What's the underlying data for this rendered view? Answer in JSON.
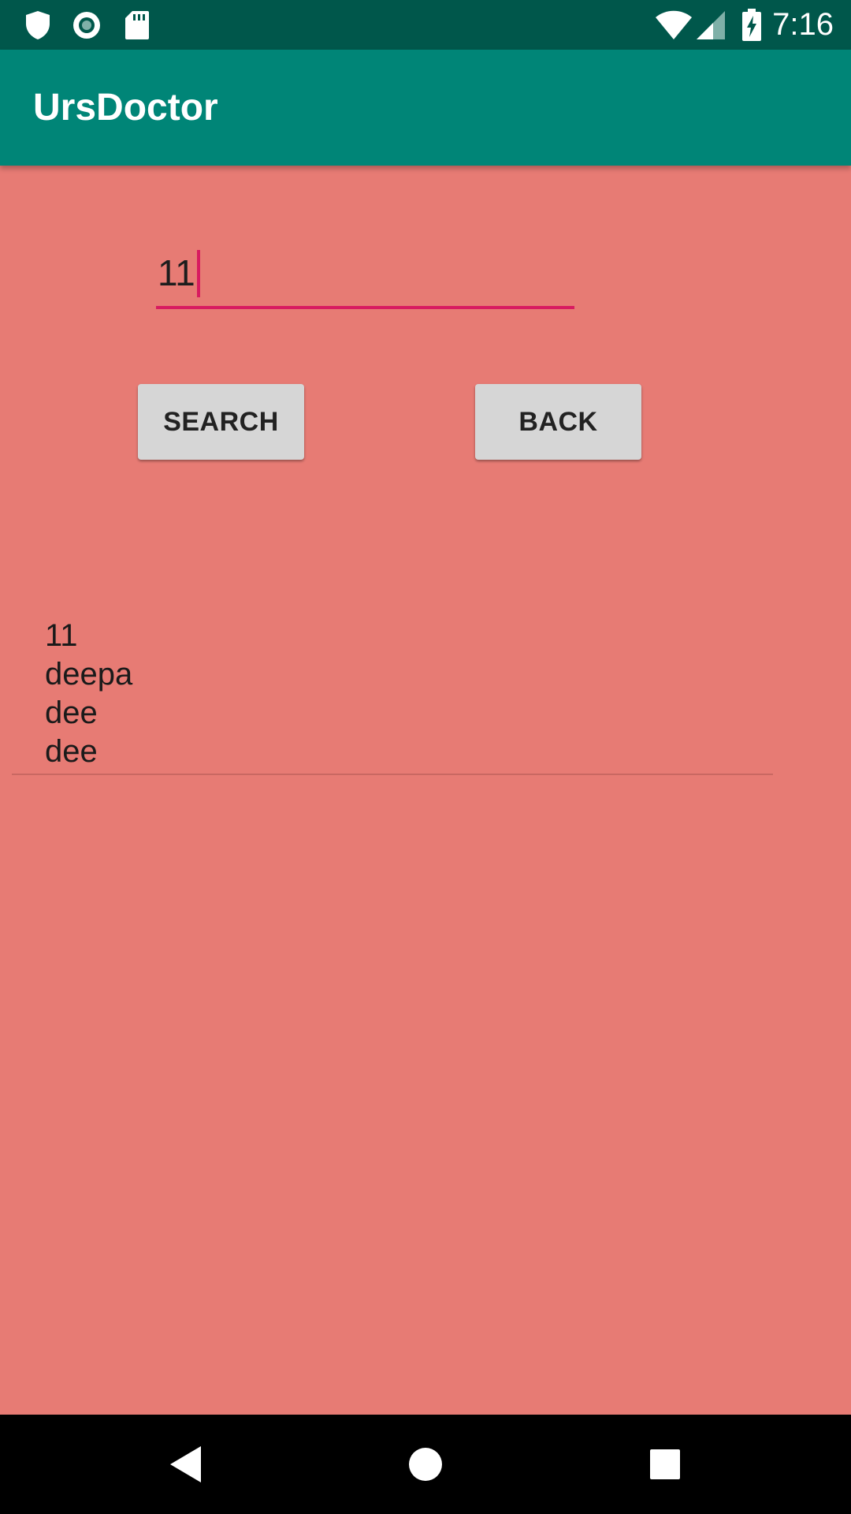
{
  "status_bar": {
    "time": "7:16",
    "icons": [
      "shield-icon",
      "record-icon",
      "sd-card-icon",
      "wifi-icon",
      "signal-icon",
      "battery-charging-icon"
    ]
  },
  "app_bar": {
    "title": "UrsDoctor"
  },
  "search": {
    "value": "11"
  },
  "buttons": {
    "search_label": "SEARCH",
    "back_label": "BACK"
  },
  "results": [
    {
      "lines": [
        "11",
        "deepa",
        "dee",
        "dee"
      ]
    }
  ],
  "nav_bar": {
    "icons": [
      "back-triangle-icon",
      "home-circle-icon",
      "recents-square-icon"
    ]
  },
  "colors": {
    "status_bar": "#00574b",
    "app_bar": "#008577",
    "background": "#e77b74",
    "accent": "#d81b60",
    "button": "#d6d6d6"
  }
}
